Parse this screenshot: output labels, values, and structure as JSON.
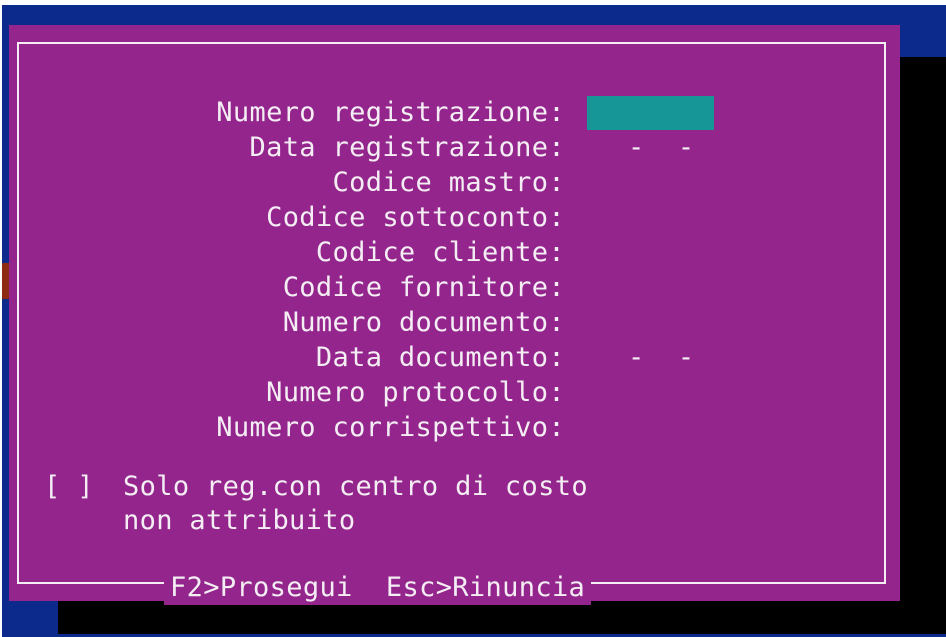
{
  "form": {
    "fields": [
      {
        "label": "Numero registrazione:",
        "value": ""
      },
      {
        "label": "Data registrazione:",
        "value": "-  -"
      },
      {
        "label": "Codice mastro:",
        "value": ""
      },
      {
        "label": "Codice sottoconto:",
        "value": ""
      },
      {
        "label": "Codice cliente:",
        "value": ""
      },
      {
        "label": "Codice fornitore:",
        "value": ""
      },
      {
        "label": "Numero documento:",
        "value": ""
      },
      {
        "label": "Data documento:",
        "value": "-  -"
      },
      {
        "label": "Numero protocollo:",
        "value": ""
      },
      {
        "label": "Numero corrispettivo:",
        "value": ""
      }
    ],
    "checkbox": {
      "box": "[ ]",
      "label_line1": "Solo reg.con centro di costo",
      "label_line2": "non attribuito"
    }
  },
  "footer": {
    "proceed": "F2>Prosegui",
    "cancel": "Esc>Rinuncia"
  },
  "colors": {
    "screen_bg": "#0b2a8c",
    "dialog_bg": "#93258c",
    "text": "#f4eef4",
    "active_field": "#169696",
    "shadow": "#000000"
  }
}
